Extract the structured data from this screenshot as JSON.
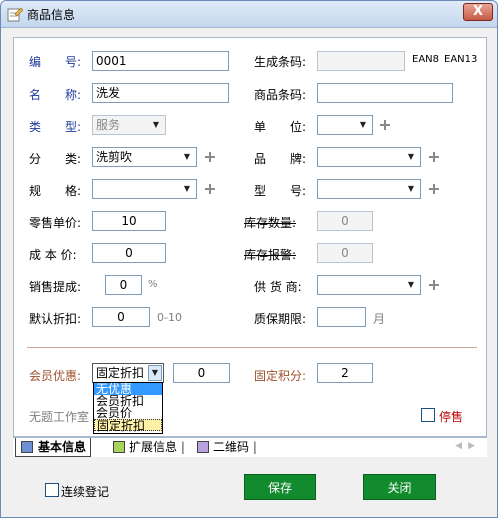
{
  "window": {
    "title": "商品信息",
    "close_label": "X"
  },
  "form": {
    "code_label": "编　　号:",
    "code_value": "0001",
    "barcode_gen_label": "生成条码:",
    "barcode_gen_value": "",
    "ean8_label": "EAN8",
    "ean13_label": "EAN13",
    "name_label": "名　　称:",
    "name_value": "洗发",
    "product_barcode_label": "商品条码:",
    "product_barcode_value": "",
    "type_label": "类　　型:",
    "type_value": "服务",
    "unit_label": "单　　位:",
    "unit_value": "",
    "category_label": "分　　类:",
    "category_value": "洗剪吹",
    "brand_label": "品　　牌:",
    "brand_value": "",
    "spec_label": "规　　格:",
    "spec_value": "",
    "model_label": "型　　号:",
    "model_value": "",
    "retail_price_label": "零售单价:",
    "retail_price_value": "10",
    "stock_qty_label": "库存数量:",
    "stock_qty_value": "0",
    "cost_price_label": "成 本 价:",
    "cost_price_value": "0",
    "stock_alarm_label": "库存报警:",
    "stock_alarm_value": "0",
    "commission_label": "销售提成:",
    "commission_value": "0",
    "commission_unit": "%",
    "supplier_label": "供 货 商:",
    "supplier_value": "",
    "discount_label": "默认折扣:",
    "discount_value": "0",
    "discount_range": "0-10",
    "shelf_life_label": "质保期限:",
    "shelf_life_value": "",
    "shelf_life_unit": "月",
    "member_discount_label": "会员优惠:",
    "member_discount_value": "固定折扣",
    "member_discount_amount": "0",
    "fixed_points_label": "固定积分:",
    "fixed_points_value": "2",
    "member_discount_options": [
      "无优惠",
      "会员折扣",
      "会员价",
      "固定折扣"
    ],
    "workroom_label": "无题工作室",
    "stop_sale_label": "停售"
  },
  "tabs": [
    {
      "label": "基本信息",
      "color": "#6e8fd4"
    },
    {
      "label": "扩展信息",
      "color": "#a6d45a"
    },
    {
      "label": "二维码",
      "color": "#b8a2e0"
    }
  ],
  "footer": {
    "continuous_label": "连续登记",
    "save_label": "保存",
    "close_label": "关闭"
  },
  "colors": {
    "button_green": "#118b2e",
    "label_blue": "#1f3a9e",
    "label_orange": "#a0522d"
  }
}
